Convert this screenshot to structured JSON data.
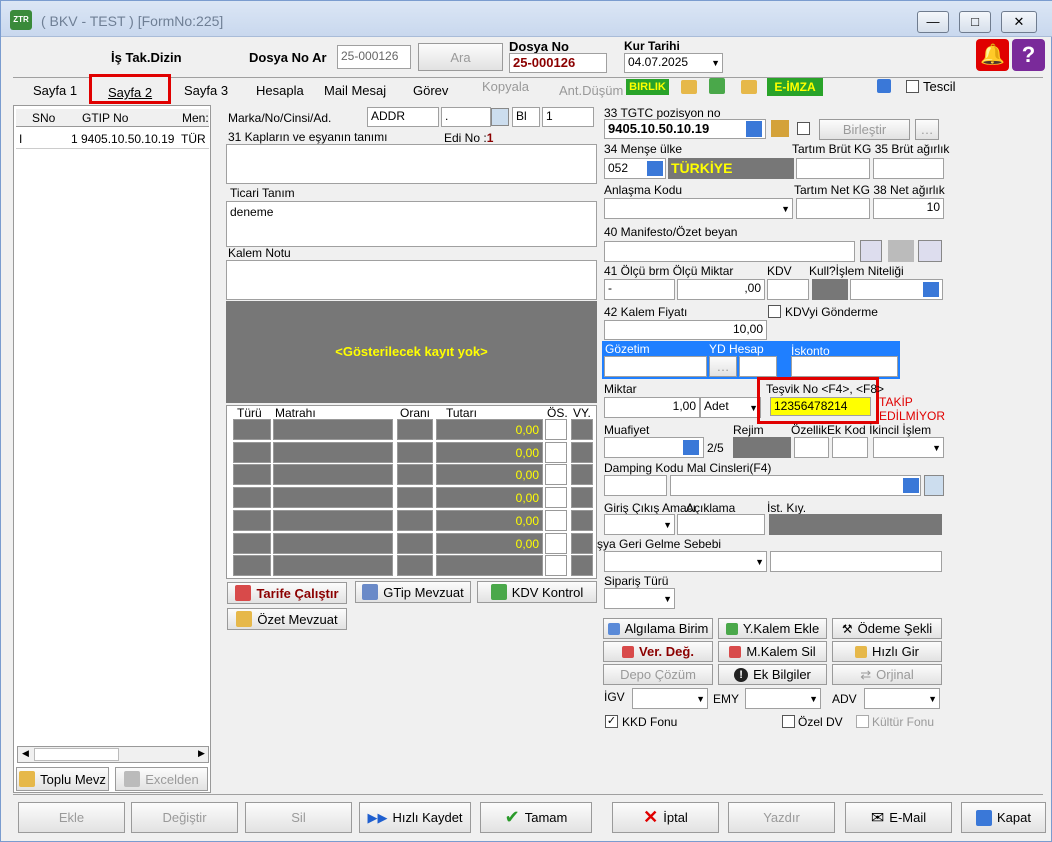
{
  "window": {
    "title": "( BKV - TEST ) [FormNo:225]",
    "min": "—",
    "max": "□",
    "close": "✕"
  },
  "header": {
    "is_tak_dizin": "İş Tak.Dizin",
    "dosya_no_ar_label": "Dosya No Ar",
    "dosya_search_value": "25-000126",
    "ara": "Ara",
    "dosya_no_label": "Dosya No",
    "dosya_no_value": "25-000126",
    "kur_tarihi_label": "Kur Tarihi",
    "kur_tarihi_value": "04.07.2025"
  },
  "tabs": {
    "sayfa1": "Sayfa 1",
    "sayfa2": "Sayfa 2",
    "sayfa3": "Sayfa 3",
    "hesapla": "Hesapla",
    "mail": "Mail Mesaj",
    "gorev": "Görev",
    "kopyala": "Kopyala",
    "antdusum": "Ant.Düşüm",
    "birlik": "BIRLIK",
    "eimza": "E-İMZA",
    "tescil": "Tescil"
  },
  "left_table": {
    "headers": [
      "SNo",
      "GTIP No",
      "Men:"
    ],
    "rows": [
      {
        "mark": "I",
        "sno": "1",
        "gtip": "9405.10.50.10.19",
        "men": "TÜR"
      }
    ],
    "toplu": "Toplu Mevz",
    "excelden": "Excelden"
  },
  "mid": {
    "marka_label": "Marka/No/Cinsi/Ad.",
    "marka_value": "ADDR",
    "marka_dot": ".",
    "bl": "Bl",
    "bl_num": "1",
    "kaplar_label": "31 Kapların ve eşyanın tanımı",
    "edi_label": "Edi No :",
    "edi_value": "1",
    "ticari_label": "Ticari Tanım",
    "ticari_value": "deneme",
    "kalem_notu_label": "Kalem Notu",
    "no_record": "<Gösterilecek kayıt yok>",
    "tax_headers": [
      "Türü",
      "Matrahı",
      "Oranı",
      "Tutarı",
      "ÖS.",
      "VY."
    ],
    "tax_values": [
      "0,00",
      "0,00",
      "0,00",
      "0,00",
      "0,00",
      "0,00"
    ],
    "tarife": "Tarife Çalıştır",
    "gtip_mevzuat": "GTip Mevzuat",
    "kdv_kontrol": "KDV Kontrol",
    "ozet_mevzuat": "Özet Mevzuat"
  },
  "right": {
    "gtip_label": "33 TGTC pozisyon no",
    "gtip_value": "9405.10.50.10.19",
    "birlestir": "Birleştir",
    "mense_label": "34 Menşe ülke",
    "mense_code": "052",
    "mense_name": "TÜRKİYE",
    "tartim_brut": "Tartım Brüt KG",
    "brut_agirlik": "35 Brüt ağırlık",
    "anlasma_label": "Anlaşma Kodu",
    "tartim_net": "Tartım Net KG",
    "net_agirlik": "38 Net ağırlık",
    "net_value": "10",
    "manifesto_label": "40 Manifesto/Özet beyan",
    "olcu_label": "41 Ölçü brm Ölçü Miktar",
    "olcu_value": "-",
    "olcu_miktar": ",00",
    "kdv": "KDV",
    "kull_islem": "Kull?İşlem Niteliği",
    "kalem_fiyati_label": "42 Kalem Fiyatı",
    "kalem_fiyati_value": "10,00",
    "kdvyi_gonderme": "KDVyi Gönderme",
    "gozetim": "Gözetim",
    "yd_hesap": "YD Hesap",
    "iskonto": "İskonto",
    "miktar_label": "Miktar",
    "miktar_value": "1,00",
    "birim": "Adet",
    "tesvik_label": "Teşvik No <F4>, <F8>",
    "tesvik_value": "12356478214",
    "takip": "TAKİP EDİLMİYOR",
    "muafiyet": "Muafiyet",
    "rejim": "Rejim",
    "ozellik": "Özellik",
    "ek_kod": "Ek Kod",
    "ikincil_islem": "İkincil İşlem",
    "rejim_value": "2/5",
    "damping": "Damping Kodu Mal Cinsleri(F4)",
    "giris_cikis": "Giriş Çıkış Amacı",
    "aciklama": "Açıklama",
    "ist_kiy": "İst. Kıy.",
    "geri_gelme": "şya Geri Gelme Sebebi",
    "siparis": "Sipariş Türü",
    "algilama": "Algılama Birim",
    "ykalem": "Y.Kalem Ekle",
    "odeme": "Ödeme Şekli",
    "verdeg": "Ver. Değ.",
    "mkalem": "M.Kalem Sil",
    "hizli_gir": "Hızlı Gir",
    "depo": "Depo Çözüm",
    "ek_bilgiler": "Ek Bilgiler",
    "orjinal": "Orjinal",
    "igv": "İGV",
    "emy": "EMY",
    "adv": "ADV",
    "kkd_fonu": "KKD Fonu",
    "ozel_dv": "Özel DV",
    "kultur_fonu": "Kültür Fonu"
  },
  "footer": {
    "ekle": "Ekle",
    "degistir": "Değiştir",
    "sil": "Sil",
    "hizli_kaydet": "Hızlı Kaydet",
    "tamam": "Tamam",
    "iptal": "İptal",
    "yazdir": "Yazdır",
    "email": "E-Mail",
    "kapat": "Kapat"
  },
  "colors": {
    "accent_red": "#e00000",
    "yellow": "#ffff00",
    "blue_panel": "#1f7fff"
  }
}
